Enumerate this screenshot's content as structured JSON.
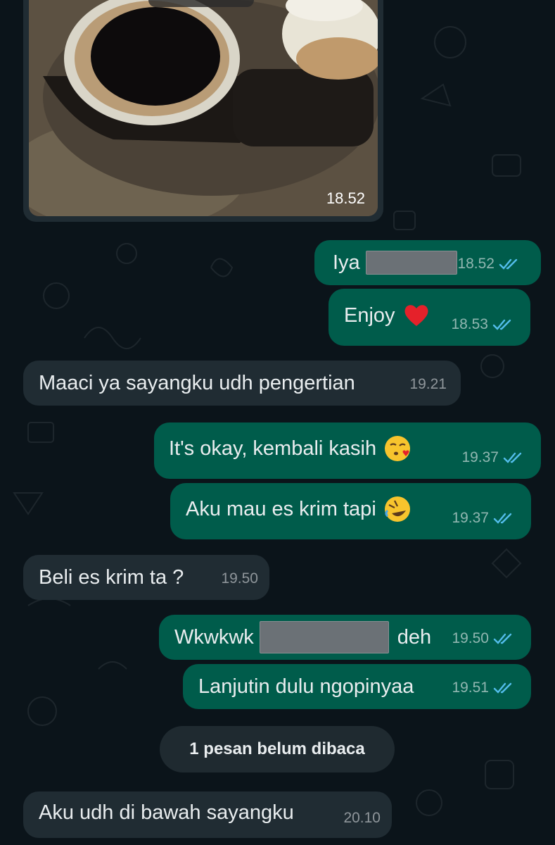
{
  "messages": [
    {
      "text": "",
      "time": "18.52"
    },
    {
      "text": "Iya",
      "time": "18.52"
    },
    {
      "text": "Enjoy",
      "time": "18.53"
    },
    {
      "text": "Maaci ya sayangku udh pengertian",
      "time": "19.21"
    },
    {
      "text": "It's okay, kembali kasih",
      "time": "19.37"
    },
    {
      "text": "Aku mau es krim tapi",
      "time": "19.37"
    },
    {
      "text": "Beli es krim ta ?",
      "time": "19.50"
    },
    {
      "text": "Wkwkwk",
      "text2": "deh",
      "time": "19.50"
    },
    {
      "text": "Lanjutin dulu ngopinyaa",
      "time": "19.51"
    },
    {
      "text": "Aku udh di bawah sayangku",
      "time": "20.10"
    }
  ],
  "unread_banner": "1 pesan belum dibaca",
  "colors": {
    "background": "#0b141a",
    "outgoing_bubble": "#005c4b",
    "incoming_bubble": "#202c33",
    "read_ticks": "#53bdeb"
  },
  "icons": {
    "read_receipt": "double-check-icon",
    "heart": "red-heart-emoji",
    "kiss": "face-blowing-kiss-emoji",
    "laugh": "rolling-laughing-emoji"
  }
}
